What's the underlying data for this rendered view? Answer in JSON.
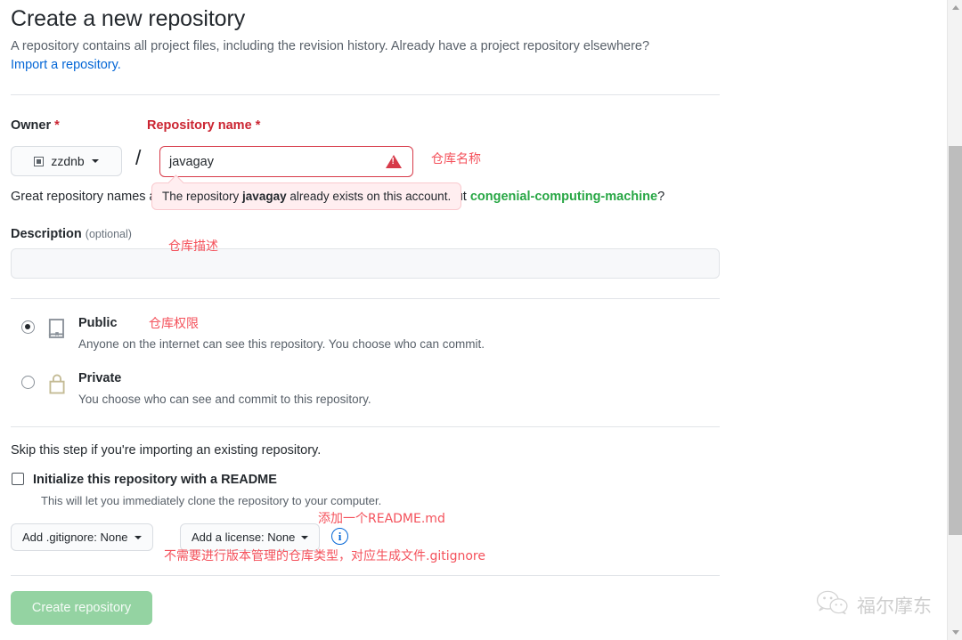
{
  "header": {
    "title": "Create a new repository",
    "lead_text": "A repository contains all project files, including the revision history. Already have a project repository elsewhere?",
    "import_link": "Import a repository."
  },
  "owner": {
    "label": "Owner",
    "required_mark": "*",
    "selected": "zzdnb",
    "avatar_icon": "avatar-square-icon",
    "caret_icon": "chevron-down-icon",
    "separator": "/"
  },
  "repository_name": {
    "label": "Repository name",
    "required_mark": "*",
    "value": "javagay",
    "placeholder": "",
    "state": "error",
    "error_icon": "alert-triangle-icon",
    "annotation": "仓库名称",
    "tooltip_prefix": "The repository ",
    "tooltip_name": "javagay",
    "tooltip_suffix": " already exists on this account."
  },
  "suggestion": {
    "prefix": "Great repository names are short and memorable. Need inspiration? How about ",
    "name": "congenial-computing-machine",
    "suffix": "?"
  },
  "description": {
    "label": "Description",
    "optional": "(optional)",
    "value": "",
    "placeholder": "",
    "annotation": "仓库描述"
  },
  "visibility": {
    "annotation": "仓库权限",
    "options": [
      {
        "id": "public",
        "title": "Public",
        "description": "Anyone on the internet can see this repository. You choose who can commit.",
        "icon": "repo-book-icon",
        "selected": true
      },
      {
        "id": "private",
        "title": "Private",
        "description": "You choose who can see and commit to this repository.",
        "icon": "lock-icon",
        "selected": false
      }
    ]
  },
  "initialize": {
    "skip_text": "Skip this step if you're importing an existing repository.",
    "readme_label": "Initialize this repository with a README",
    "readme_desc": "This will let you immediately clone the repository to your computer.",
    "readme_checked": false,
    "readme_annotation": "添加一个README.md",
    "gitignore_button": "Add .gitignore: None",
    "license_button": "Add a license: None",
    "info_icon": "info-circle-icon",
    "bottom_annotation": "不需要进行版本管理的仓库类型，对应生成文件.gitignore"
  },
  "submit": {
    "label": "Create repository",
    "disabled": true
  },
  "watermark": {
    "text": "福尔摩东",
    "icon": "wechat-logo-icon"
  },
  "scrollbar": {
    "up_icon": "chevron-up-icon",
    "down_icon": "chevron-down-icon"
  },
  "colors": {
    "accent_blue": "#0366d6",
    "danger_red": "#d73a49",
    "success_green": "#28a745",
    "annotation_red": "#f4515b",
    "button_green": "#94d3a2"
  }
}
